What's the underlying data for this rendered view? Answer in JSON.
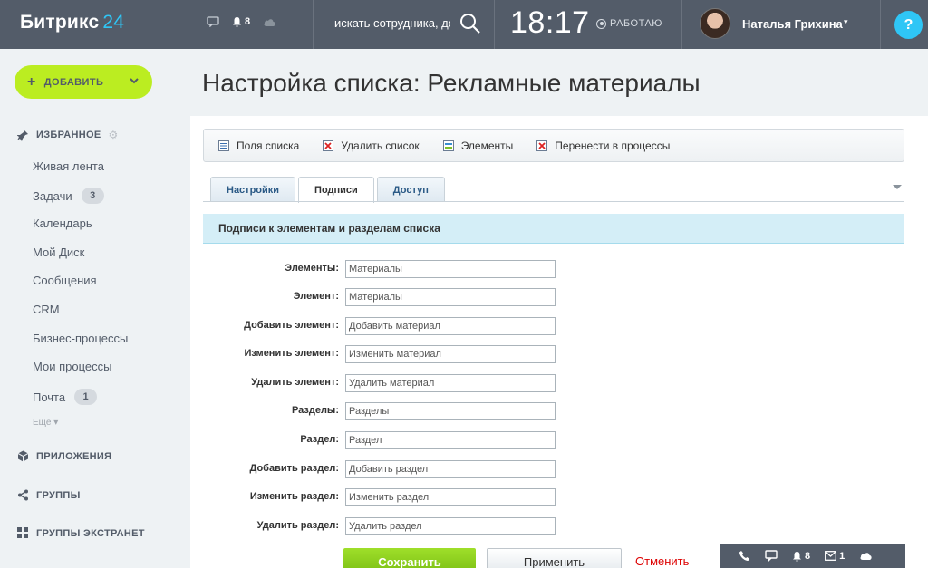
{
  "header": {
    "logo_text": "Битрикс",
    "logo_num": "24",
    "notifications_count": "8",
    "search_placeholder": "искать сотрудника, до",
    "clock": "18:17",
    "status": "РАБОТАЮ",
    "user_name": "Наталья Грихина",
    "help": "?"
  },
  "sidebar": {
    "add_label": "ДОБАВИТЬ",
    "favorites_label": "ИЗБРАННОЕ",
    "items": [
      {
        "label": "Живая лента",
        "badge": ""
      },
      {
        "label": "Задачи",
        "badge": "3"
      },
      {
        "label": "Календарь",
        "badge": ""
      },
      {
        "label": "Мой Диск",
        "badge": ""
      },
      {
        "label": "Сообщения",
        "badge": ""
      },
      {
        "label": "CRM",
        "badge": ""
      },
      {
        "label": "Бизнес-процессы",
        "badge": ""
      },
      {
        "label": "Мои процессы",
        "badge": ""
      },
      {
        "label": "Почта",
        "badge": "1"
      }
    ],
    "more_label": "Ещё",
    "apps_label": "ПРИЛОЖЕНИЯ",
    "groups_label": "ГРУППЫ",
    "extranet_label": "ГРУППЫ ЭКСТРАНЕТ"
  },
  "main": {
    "title": "Настройка списка: Рекламные материалы",
    "toolbar": [
      {
        "label": "Поля списка",
        "icon": "fields-icon"
      },
      {
        "label": "Удалить список",
        "icon": "delete-list-icon"
      },
      {
        "label": "Элементы",
        "icon": "elements-icon"
      },
      {
        "label": "Перенести в процессы",
        "icon": "move-icon"
      }
    ],
    "tabs": [
      "Настройки",
      "Подписи",
      "Доступ"
    ],
    "active_tab": "Подписи",
    "section_title": "Подписи к элементам и разделам списка",
    "fields": [
      {
        "label": "Элементы:",
        "value": "Материалы"
      },
      {
        "label": "Элемент:",
        "value": "Материалы"
      },
      {
        "label": "Добавить элемент:",
        "value": "Добавить материал"
      },
      {
        "label": "Изменить элемент:",
        "value": "Изменить материал"
      },
      {
        "label": "Удалить элемент:",
        "value": "Удалить материал"
      },
      {
        "label": "Разделы:",
        "value": "Разделы"
      },
      {
        "label": "Раздел:",
        "value": "Раздел"
      },
      {
        "label": "Добавить раздел:",
        "value": "Добавить раздел"
      },
      {
        "label": "Изменить раздел:",
        "value": "Изменить раздел"
      },
      {
        "label": "Удалить раздел:",
        "value": "Удалить раздел"
      }
    ],
    "save_label": "Сохранить",
    "apply_label": "Применить",
    "cancel_label": "Отменить"
  },
  "bottom_bar": {
    "notifications_count": "8",
    "mail_count": "1"
  },
  "colors": {
    "header_bg": "#535c69",
    "accent_blue": "#2fc6f6",
    "add_button": "#bbed21",
    "save_button": "#8fd11c",
    "cancel_text": "#dd0000"
  }
}
